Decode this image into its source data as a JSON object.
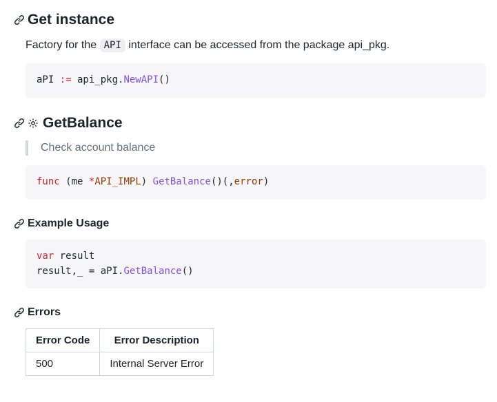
{
  "sections": {
    "getInstance": {
      "title": "Get instance",
      "desc_pre": "Factory for the ",
      "desc_code": "API",
      "desc_post": " interface can be accessed from the package api_pkg.",
      "code": {
        "t1": "aPI ",
        "op": ":=",
        "t2": " api_pkg.",
        "call": "NewAPI",
        "paren": "()"
      }
    },
    "getBalance": {
      "title": "GetBalance",
      "quote": "Check account balance",
      "code": {
        "kw": "func",
        "sp1": " ",
        "lp1": "(",
        "recv": "me ",
        "star": "*",
        "type": "API_IMPL",
        "rp1": ")",
        "sp2": " ",
        "name": "GetBalance",
        "sig1": "()(",
        "comma": ",",
        "err": "error",
        "rp2": ")"
      }
    },
    "example": {
      "title": "Example Usage",
      "code": {
        "kw": "var",
        "line1_rest": " result ",
        "line2_pre": "result,_ = aPI.",
        "call": "GetBalance",
        "paren": "()"
      }
    },
    "errors": {
      "title": "Errors",
      "headers": {
        "code": "Error Code",
        "desc": "Error Description"
      },
      "rows": [
        {
          "code": "500",
          "desc": "Internal Server Error"
        }
      ]
    }
  }
}
